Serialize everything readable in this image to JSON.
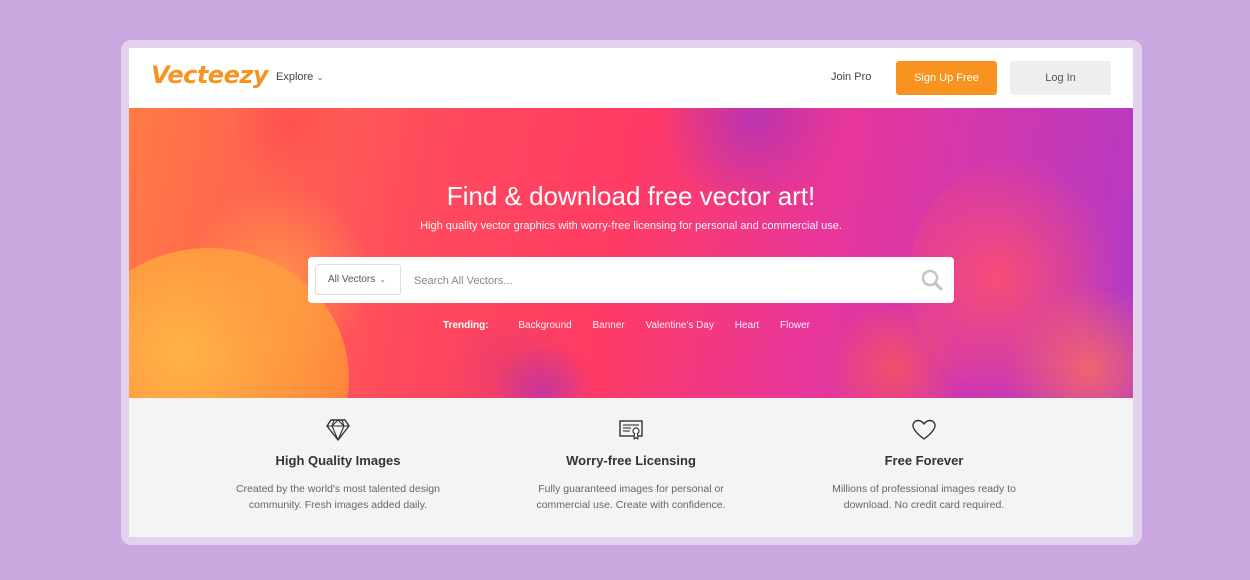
{
  "header": {
    "logo": "Vecteezy",
    "explore": "Explore",
    "join_pro": "Join Pro",
    "sign_up": "Sign Up Free",
    "log_in": "Log In"
  },
  "hero": {
    "title": "Find & download free vector art!",
    "subtitle": "High quality vector graphics with worry-free licensing for personal and commercial use."
  },
  "search": {
    "category": "All Vectors",
    "placeholder": "Search All Vectors..."
  },
  "trending": {
    "label": "Trending:",
    "tags": [
      "Background",
      "Banner",
      "Valentine's Day",
      "Heart",
      "Flower"
    ]
  },
  "features": [
    {
      "icon": "diamond-icon",
      "title": "High Quality Images",
      "desc": "Created by the world's most talented design community. Fresh images added daily."
    },
    {
      "icon": "certificate-icon",
      "title": "Worry-free Licensing",
      "desc": "Fully guaranteed images for personal or commercial use. Create with confidence."
    },
    {
      "icon": "heart-icon",
      "title": "Free Forever",
      "desc": "Millions of professional images ready to download. No credit card required."
    }
  ],
  "colors": {
    "brand": "#f7931e",
    "page_background": "#cca8e0",
    "hero_gradient_start": "#ff7a45",
    "hero_gradient_end": "#b23ac6"
  }
}
